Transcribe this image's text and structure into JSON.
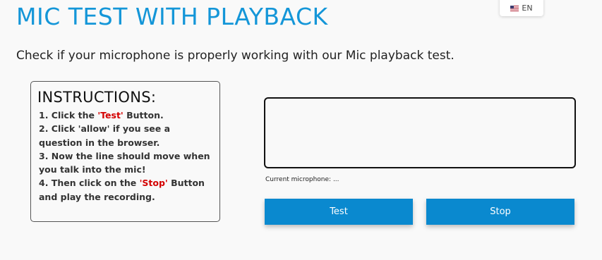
{
  "header": {
    "title": "MIC TEST WITH PLAYBACK",
    "subtitle": "Check if your microphone is properly working with our Mic playback test."
  },
  "language": {
    "flag_icon": "us-flag-icon",
    "label": "EN"
  },
  "instructions": {
    "heading": "INSTRUCTIONS:",
    "steps": [
      {
        "before": "1. Click the ",
        "highlight": "'Test'",
        "after": " Button."
      },
      {
        "before": "2. Click 'allow' if you see a question in the browser.",
        "highlight": "",
        "after": ""
      },
      {
        "before": "3. Now the line should move when you talk into the mic!",
        "highlight": "",
        "after": ""
      },
      {
        "before": "4.  Then click on the ",
        "highlight": "'Stop'",
        "after": " Button and play the recording."
      }
    ]
  },
  "visualizer": {
    "microphone_label": "Current microphone: ..."
  },
  "buttons": {
    "test_label": "Test",
    "stop_label": "Stop"
  },
  "colors": {
    "title": "#1496d8",
    "button": "#0a89cf",
    "highlight": "#d40000"
  }
}
